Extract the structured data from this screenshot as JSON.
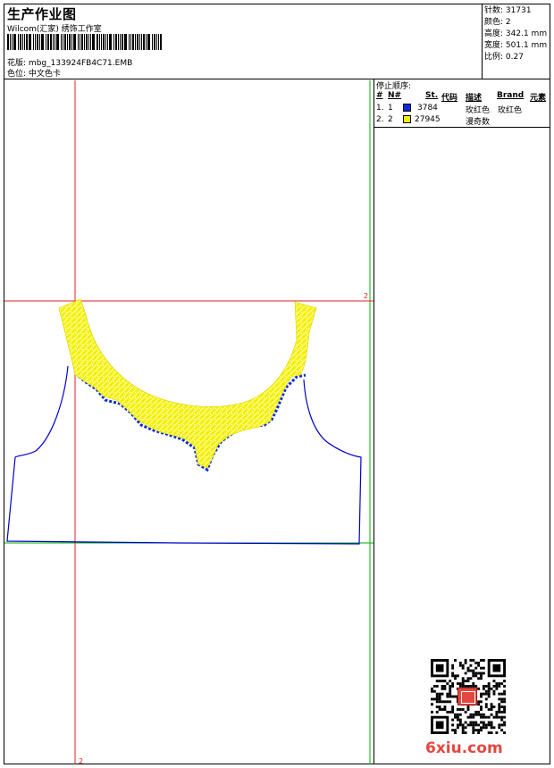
{
  "header": {
    "title": "生产作业图",
    "company": "Wilcom(汇家) 绣饰工作室",
    "design_file_label": "花版:",
    "design_file": "mbg_133924FB4C71.EMB",
    "colorway_label": "色位:",
    "colorway": "中文色卡"
  },
  "specs": {
    "stitches_label": "针数:",
    "stitches": "31731",
    "colors_label": "颜色:",
    "colors": "2",
    "height_label": "高度:",
    "height": "342.1 mm",
    "width_label": "宽度:",
    "width": "501.1 mm",
    "scale_label": "比例:",
    "scale": "0.27"
  },
  "stop_sequence": {
    "title": "停止顺序:",
    "columns": [
      "#",
      "N#",
      "St.",
      "代码",
      "描述",
      "Brand",
      "元素"
    ],
    "rows": [
      {
        "index": "1.",
        "n": "1",
        "color": "#0a2ad8",
        "stitches": "3784",
        "description": "玫红色",
        "brand": "玫红色"
      },
      {
        "index": "2.",
        "n": "2",
        "color": "#f0f000",
        "stitches": "27945",
        "description": "漫奇数",
        "brand": ""
      }
    ]
  },
  "canvas": {
    "guide_label_top": "2",
    "guide_label_bottom": "2",
    "colors": {
      "outline": "#0000cc",
      "fill": "#f5f20a",
      "guide_red": "#e02020",
      "guide_green": "#00b000"
    }
  },
  "watermark": "6xiu.com",
  "icons": {
    "qr": "qr-code-icon",
    "seal": "seal-stamp-icon"
  }
}
